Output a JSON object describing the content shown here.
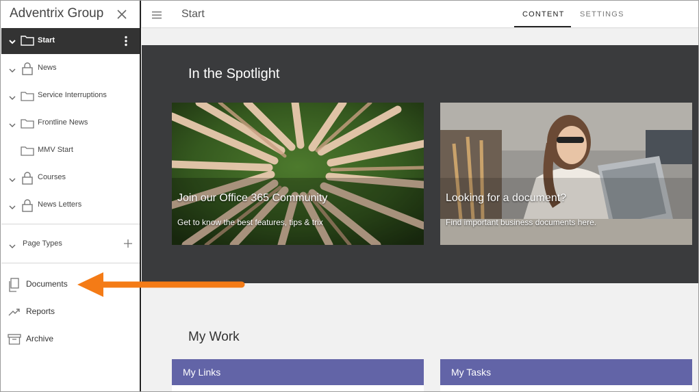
{
  "sidebar": {
    "brand": "Adventrix Group",
    "root": {
      "label": "Start"
    },
    "items": [
      {
        "label": "News",
        "icon": "lock-icon"
      },
      {
        "label": "Service Interruptions",
        "icon": "folder-icon"
      },
      {
        "label": "Frontline News",
        "icon": "folder-icon"
      },
      {
        "label": "MMV Start",
        "icon": "folder-icon"
      },
      {
        "label": "Courses",
        "icon": "lock-icon"
      },
      {
        "label": "News Letters",
        "icon": "lock-icon"
      }
    ],
    "page_types": "Page Types",
    "links": [
      {
        "label": "Documents",
        "icon": "documents-icon"
      },
      {
        "label": "Reports",
        "icon": "trend-icon"
      },
      {
        "label": "Archive",
        "icon": "archive-icon"
      }
    ]
  },
  "topbar": {
    "title": "Start",
    "tabs": [
      {
        "label": "CONTENT",
        "active": true
      },
      {
        "label": "SETTINGS",
        "active": false
      }
    ]
  },
  "spotlight": {
    "title": "In the Spotlight",
    "cards": [
      {
        "title": "Join our Office 365 Community",
        "subtitle": "Get to know the best features, tips & trix"
      },
      {
        "title": "Looking for a document?",
        "subtitle": "Find important business documents here."
      }
    ]
  },
  "mywork": {
    "title": "My Work",
    "panels": [
      {
        "title": "My Links"
      },
      {
        "title": "My Tasks"
      }
    ]
  },
  "colors": {
    "sidebar_root_bg": "#333333",
    "spotlight_bg": "#3a3b3d",
    "panel_header": "#6264a7",
    "annotation_arrow": "#f47b16"
  }
}
